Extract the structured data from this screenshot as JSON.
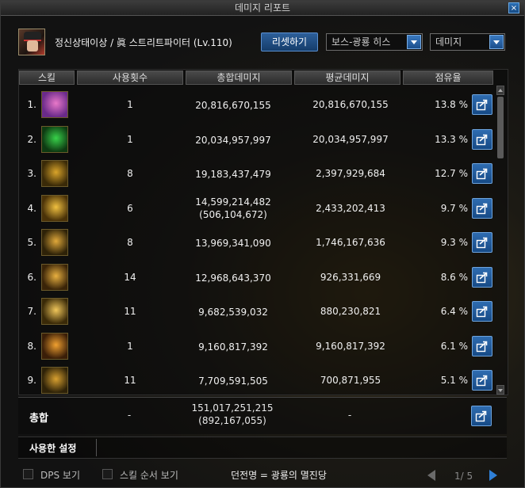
{
  "window": {
    "title": "데미지 리포트",
    "close_label": "×"
  },
  "header": {
    "char_name": "정신상태이상",
    "separator": "/",
    "char_class": "眞 스트리트파이터 (Lv.110)",
    "reset_button": "리셋하기",
    "boss_select": "보스-광룡 히스",
    "type_select": "데미지"
  },
  "table": {
    "headers": [
      "스킬",
      "사용횟수",
      "총합데미지",
      "평균데미지",
      "점유율"
    ],
    "rows": [
      {
        "rank": "1.",
        "count": "1",
        "total": "20,816,670,155",
        "sub": "",
        "avg": "20,816,670,155",
        "pct": "13.8 %",
        "icon": "purple-burst-icon",
        "c1": "#6a2a8a",
        "c2": "#e878c8"
      },
      {
        "rank": "2.",
        "count": "1",
        "total": "20,034,957,997",
        "sub": "",
        "avg": "20,034,957,997",
        "pct": "13.3 %",
        "icon": "green-poison-icon",
        "c1": "#0e3a12",
        "c2": "#38d24a"
      },
      {
        "rank": "3.",
        "count": "8",
        "total": "19,183,437,479",
        "sub": "",
        "avg": "2,397,929,684",
        "pct": "12.7 %",
        "icon": "golden-spikes-icon",
        "c1": "#3a2a08",
        "c2": "#d9a42a"
      },
      {
        "rank": "4.",
        "count": "6",
        "total": "14,599,214,482",
        "sub": "(506,104,672)",
        "avg": "2,433,202,413",
        "pct": "9.7 %",
        "icon": "explosion-icon",
        "c1": "#4a3208",
        "c2": "#f0c040"
      },
      {
        "rank": "5.",
        "count": "8",
        "total": "13,969,341,090",
        "sub": "",
        "avg": "1,746,167,636",
        "pct": "9.3 %",
        "icon": "fist-strike-icon",
        "c1": "#2e2208",
        "c2": "#e0a83a"
      },
      {
        "rank": "6.",
        "count": "14",
        "total": "12,968,643,370",
        "sub": "",
        "avg": "926,331,669",
        "pct": "8.6 %",
        "icon": "barrel-icon",
        "c1": "#3a2408",
        "c2": "#e8b040"
      },
      {
        "rank": "7.",
        "count": "11",
        "total": "9,682,539,032",
        "sub": "",
        "avg": "880,230,821",
        "pct": "6.4 %",
        "icon": "dash-slash-icon",
        "c1": "#3a2a08",
        "c2": "#f0c65a"
      },
      {
        "rank": "8.",
        "count": "1",
        "total": "9,160,817,392",
        "sub": "",
        "avg": "9,160,817,392",
        "pct": "6.1 %",
        "icon": "blade-flash-icon",
        "c1": "#3a1e08",
        "c2": "#f0a030"
      },
      {
        "rank": "9.",
        "count": "11",
        "total": "7,709,591,505",
        "sub": "",
        "avg": "700,871,955",
        "pct": "5.1 %",
        "icon": "claw-icon",
        "c1": "#2e2208",
        "c2": "#d8a030"
      }
    ]
  },
  "total": {
    "label": "총합",
    "count": "-",
    "damage": "151,017,251,215",
    "damage_sub": "(892,167,055)",
    "avg": "-"
  },
  "used_settings": {
    "label": "사용한 설정"
  },
  "footer": {
    "dps_label": "DPS 보기",
    "skill_order_label": "스킬 순서 보기",
    "dungeon": "던전명 = 광룡의 멸진당",
    "page": "1/ 5"
  }
}
